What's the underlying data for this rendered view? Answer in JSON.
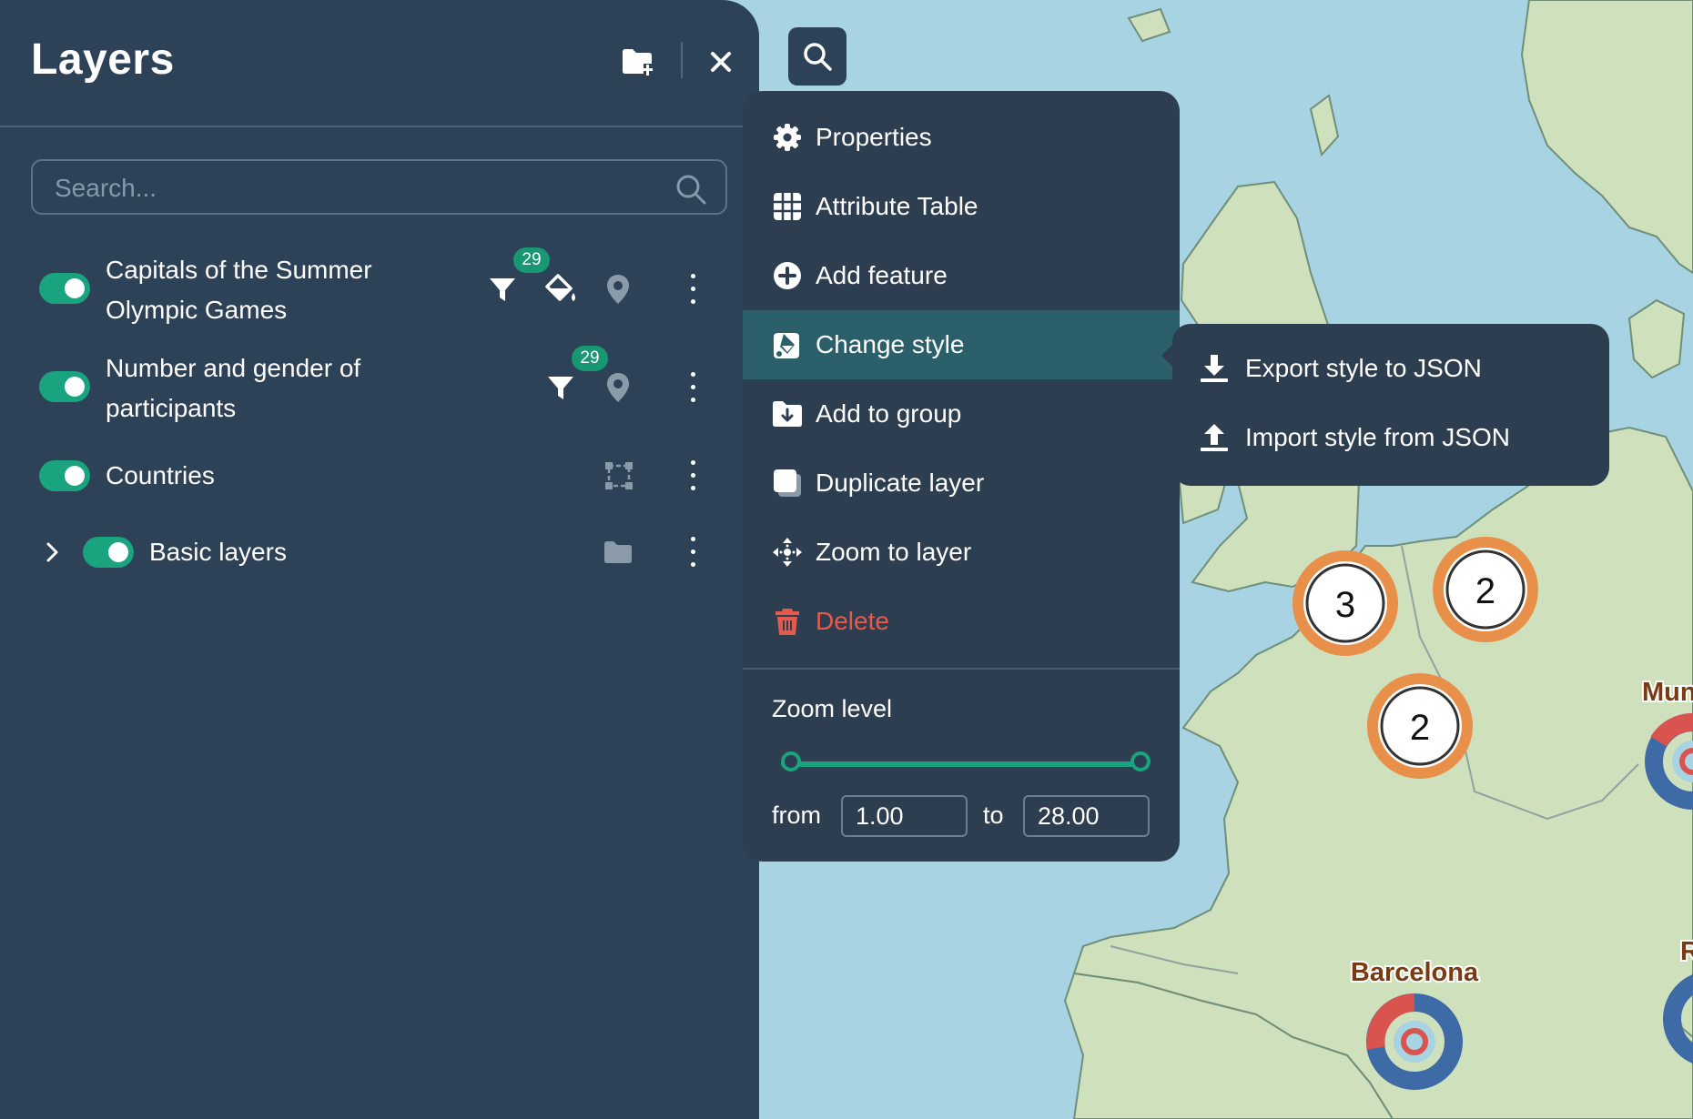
{
  "panel": {
    "title": "Layers",
    "search_placeholder": "Search..."
  },
  "layers": [
    {
      "label_line1": "Capitals of the Summer",
      "label_line2": "Olympic Games",
      "badge": "29"
    },
    {
      "label_line1": "Number and gender of",
      "label_line2": "participants",
      "badge": "29"
    },
    {
      "label": "Countries"
    },
    {
      "label": "Basic layers"
    }
  ],
  "context_menu": {
    "items": [
      {
        "label": "Properties",
        "icon": "gear-icon"
      },
      {
        "label": "Attribute Table",
        "icon": "table-icon"
      },
      {
        "label": "Add feature",
        "icon": "plus-circle-icon"
      },
      {
        "label": "Change style",
        "icon": "style-icon"
      },
      {
        "label": "Add to group",
        "icon": "folder-add-icon"
      },
      {
        "label": "Duplicate layer",
        "icon": "copy-icon"
      },
      {
        "label": "Zoom to layer",
        "icon": "zoom-extent-icon"
      },
      {
        "label": "Delete",
        "icon": "trash-icon"
      }
    ],
    "zoom_level_label": "Zoom level",
    "from_label": "from",
    "to_label": "to",
    "from_value": "1.00",
    "to_value": "28.00"
  },
  "submenu": {
    "items": [
      {
        "label": "Export style to JSON",
        "icon": "download-icon"
      },
      {
        "label": "Import style from JSON",
        "icon": "upload-icon"
      }
    ]
  },
  "map": {
    "clusters": [
      "3",
      "2",
      "2"
    ],
    "city_labels": [
      "Barcelona",
      "Mun",
      "R"
    ]
  },
  "colors": {
    "panel_bg": "#2d4256",
    "menu_bg": "#2c3e50",
    "accent": "#1aa37f",
    "active_item": "#2b5f6a",
    "danger": "#e55a4a",
    "sea": "#a7d3e3",
    "land": "#cfe0bc",
    "cluster_ring": "#e8904a",
    "city_label": "#7a3b12"
  }
}
